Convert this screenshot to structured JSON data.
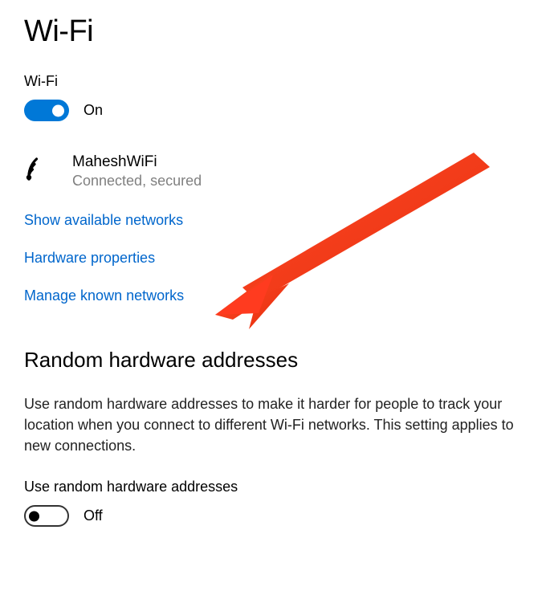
{
  "page": {
    "title": "Wi-Fi"
  },
  "wifi": {
    "label": "Wi-Fi",
    "toggle_state": "On"
  },
  "network": {
    "name": "MaheshWiFi",
    "status": "Connected, secured"
  },
  "links": {
    "show_available": "Show available networks",
    "hardware_properties": "Hardware properties",
    "manage_known": "Manage known networks"
  },
  "random_hw": {
    "heading": "Random hardware addresses",
    "description": "Use random hardware addresses to make it harder for people to track your location when you connect to different Wi-Fi networks. This setting applies to new connections.",
    "label": "Use random hardware addresses",
    "toggle_state": "Off"
  },
  "annotation": {
    "arrow_points_to": "manage_known_networks_link",
    "arrow_color": "#ff3b1f"
  }
}
